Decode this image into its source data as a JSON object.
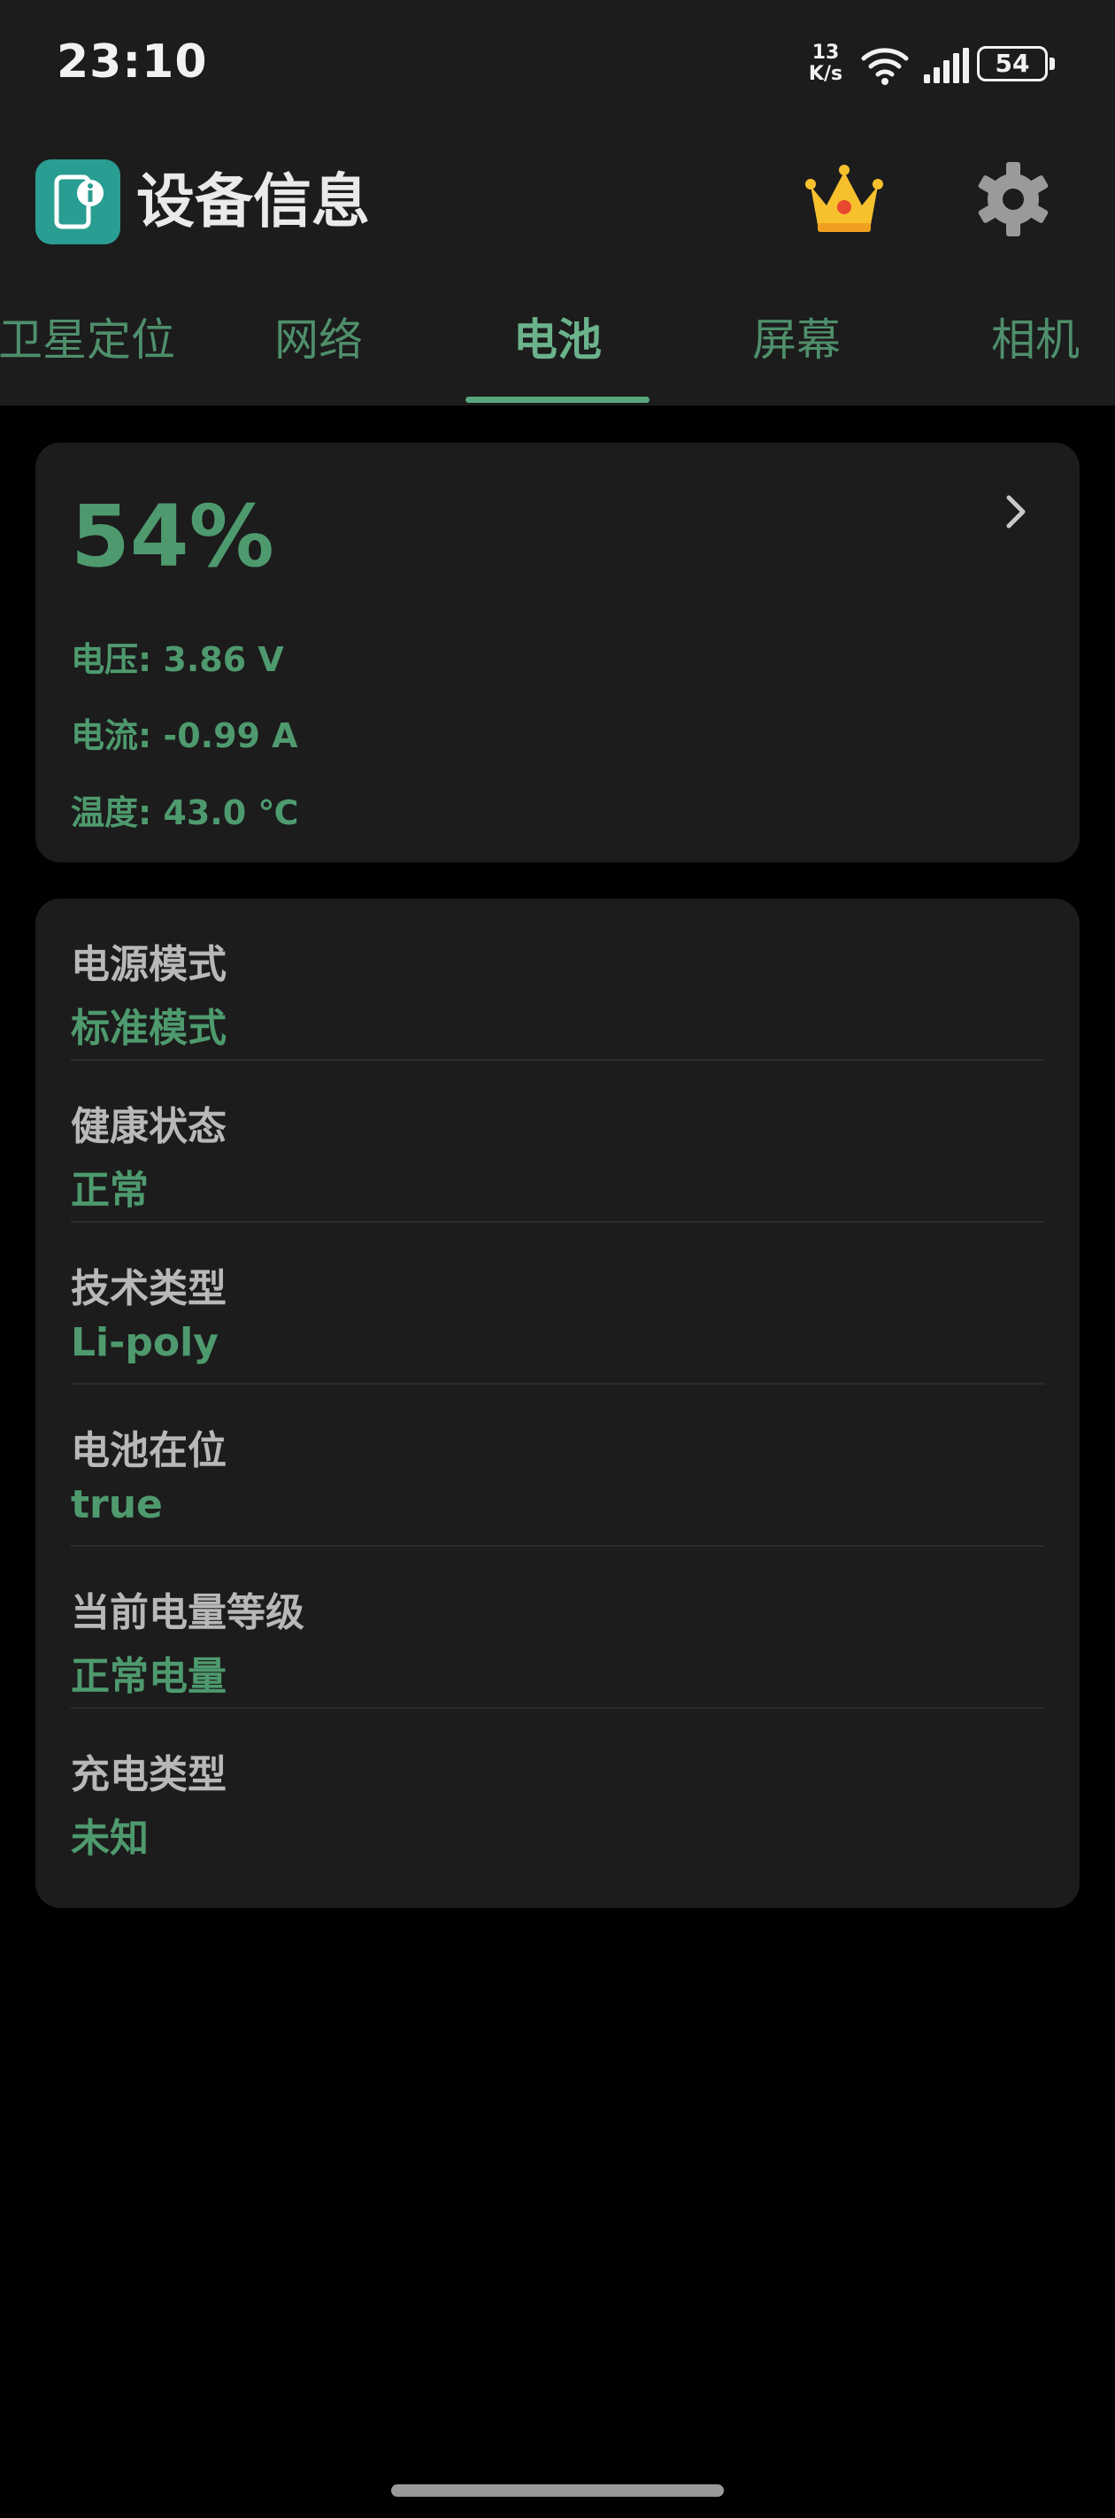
{
  "status_bar": {
    "time": "23:10",
    "net_speed_value": "13",
    "net_speed_unit": "K/s",
    "battery_level": "54",
    "icons": [
      "wifi-icon",
      "signal-icon",
      "battery-icon"
    ]
  },
  "header": {
    "title": "设备信息",
    "icons": [
      "app-logo-icon",
      "crown-icon",
      "gear-icon"
    ]
  },
  "tabs": [
    {
      "label": "卫星定位"
    },
    {
      "label": "网络"
    },
    {
      "label": "电池"
    },
    {
      "label": "屏幕"
    },
    {
      "label": "相机"
    }
  ],
  "active_tab": "电池",
  "battery_summary": {
    "level": "54%",
    "voltage": "电压:  3.86 V",
    "current": "电流:  -0.99 A",
    "temperature": "温度:  43.0 ℃"
  },
  "details": [
    {
      "label": "电源模式",
      "value": "标准模式"
    },
    {
      "label": "健康状态",
      "value": "正常"
    },
    {
      "label": "技术类型",
      "value": "Li-poly"
    },
    {
      "label": "电池在位",
      "value": "true"
    },
    {
      "label": "当前电量等级",
      "value": "正常电量"
    },
    {
      "label": "充电类型",
      "value": "未知"
    }
  ],
  "colors": {
    "accent": "#4e9a6e",
    "tab_indicator": "#5aa67d",
    "app_icon": "#2a9d92",
    "card": "#1c1c1c",
    "background": "#000000"
  }
}
